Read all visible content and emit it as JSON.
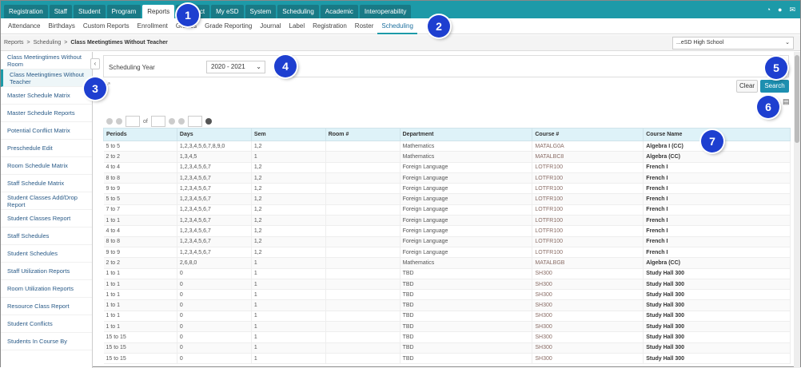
{
  "topnav": {
    "tabs": [
      {
        "label": "Registration",
        "active": false
      },
      {
        "label": "Staff",
        "active": false
      },
      {
        "label": "Student",
        "active": false
      },
      {
        "label": "Program",
        "active": false
      },
      {
        "label": "Reports",
        "active": true
      },
      {
        "label": "Conduct",
        "active": false
      },
      {
        "label": "My eSD",
        "active": false
      },
      {
        "label": "System",
        "active": false
      },
      {
        "label": "Scheduling",
        "active": false
      },
      {
        "label": "Academic",
        "active": false
      },
      {
        "label": "Interoperability",
        "active": false
      }
    ]
  },
  "subnav": {
    "items": [
      {
        "label": "Attendance",
        "active": false
      },
      {
        "label": "Birthdays",
        "active": false
      },
      {
        "label": "Custom Reports",
        "active": false
      },
      {
        "label": "Enrollment",
        "active": false
      },
      {
        "label": "Grades",
        "active": false
      },
      {
        "label": "Grade Reporting",
        "active": false
      },
      {
        "label": "Journal",
        "active": false
      },
      {
        "label": "Label",
        "active": false
      },
      {
        "label": "Registration",
        "active": false
      },
      {
        "label": "Roster",
        "active": false
      },
      {
        "label": "Scheduling",
        "active": true
      }
    ]
  },
  "breadcrumb": {
    "items": [
      "Reports",
      "Scheduling"
    ],
    "current": "Class Meetingtimes Without Teacher"
  },
  "school_select": {
    "value": "...eSD High School"
  },
  "sidebar": {
    "items": [
      {
        "label": "Class Meetingtimes Without Room",
        "active": false
      },
      {
        "label": "Class Meetingtimes Without Teacher",
        "active": true
      },
      {
        "label": "Master Schedule Matrix",
        "active": false
      },
      {
        "label": "Master Schedule Reports",
        "active": false
      },
      {
        "label": "Potential Conflict Matrix",
        "active": false
      },
      {
        "label": "Preschedule Edit",
        "active": false
      },
      {
        "label": "Room Schedule Matrix",
        "active": false
      },
      {
        "label": "Staff Schedule Matrix",
        "active": false
      },
      {
        "label": "Student Classes Add/Drop Report",
        "active": false
      },
      {
        "label": "Student Classes Report",
        "active": false
      },
      {
        "label": "Staff Schedules",
        "active": false
      },
      {
        "label": "Student Schedules",
        "active": false
      },
      {
        "label": "Staff Utilization Reports",
        "active": false
      },
      {
        "label": "Room Utilization Reports",
        "active": false
      },
      {
        "label": "Resource Class Report",
        "active": false
      },
      {
        "label": "Student Conflicts",
        "active": false
      },
      {
        "label": "Students In Course By",
        "active": false
      }
    ]
  },
  "filter": {
    "label": "Scheduling Year",
    "year_value": "2020 - 2021"
  },
  "buttons": {
    "clear": "Clear",
    "search": "Search"
  },
  "pager": {
    "of_label": "of"
  },
  "table": {
    "columns": [
      "Periods",
      "Days",
      "Sem",
      "Room #",
      "Department",
      "Course #",
      "Course Name"
    ],
    "rows": [
      [
        "5 to 5",
        "1,2,3,4,5,6,7,8,9,0",
        "1,2",
        "",
        "Mathematics",
        "MATALG0A",
        "Algebra I (CC)"
      ],
      [
        "2 to 2",
        "1,3,4,5",
        "1",
        "",
        "Mathematics",
        "MATALBC8",
        "Algebra (CC)"
      ],
      [
        "4 to 4",
        "1,2,3,4,5,6,7",
        "1,2",
        "",
        "Foreign Language",
        "LOTFR100",
        "French I"
      ],
      [
        "8 to 8",
        "1,2,3,4,5,6,7",
        "1,2",
        "",
        "Foreign Language",
        "LOTFR100",
        "French I"
      ],
      [
        "9 to 9",
        "1,2,3,4,5,6,7",
        "1,2",
        "",
        "Foreign Language",
        "LOTFR100",
        "French I"
      ],
      [
        "5 to 5",
        "1,2,3,4,5,6,7",
        "1,2",
        "",
        "Foreign Language",
        "LOTFR100",
        "French I"
      ],
      [
        "7 to 7",
        "1,2,3,4,5,6,7",
        "1,2",
        "",
        "Foreign Language",
        "LOTFR100",
        "French I"
      ],
      [
        "1 to 1",
        "1,2,3,4,5,6,7",
        "1,2",
        "",
        "Foreign Language",
        "LOTFR100",
        "French I"
      ],
      [
        "4 to 4",
        "1,2,3,4,5,6,7",
        "1,2",
        "",
        "Foreign Language",
        "LOTFR100",
        "French I"
      ],
      [
        "8 to 8",
        "1,2,3,4,5,6,7",
        "1,2",
        "",
        "Foreign Language",
        "LOTFR100",
        "French I"
      ],
      [
        "9 to 9",
        "1,2,3,4,5,6,7",
        "1,2",
        "",
        "Foreign Language",
        "LOTFR100",
        "French I"
      ],
      [
        "2 to 2",
        "2,6,8,0",
        "1",
        "",
        "Mathematics",
        "MATALBGB",
        "Algebra (CC)"
      ],
      [
        "1 to 1",
        "0",
        "1",
        "",
        "TBD",
        "SH300",
        "Study Hall 300"
      ],
      [
        "1 to 1",
        "0",
        "1",
        "",
        "TBD",
        "SH300",
        "Study Hall 300"
      ],
      [
        "1 to 1",
        "0",
        "1",
        "",
        "TBD",
        "SH300",
        "Study Hall 300"
      ],
      [
        "1 to 1",
        "0",
        "1",
        "",
        "TBD",
        "SH300",
        "Study Hall 300"
      ],
      [
        "1 to 1",
        "0",
        "1",
        "",
        "TBD",
        "SH300",
        "Study Hall 300"
      ],
      [
        "1 to 1",
        "0",
        "1",
        "",
        "TBD",
        "SH300",
        "Study Hall 300"
      ],
      [
        "15 to 15",
        "0",
        "1",
        "",
        "TBD",
        "SH300",
        "Study Hall 300"
      ],
      [
        "15 to 15",
        "0",
        "1",
        "",
        "TBD",
        "SH300",
        "Study Hall 300"
      ],
      [
        "15 to 15",
        "0",
        "1",
        "",
        "TBD",
        "SH300",
        "Study Hall 300"
      ]
    ]
  },
  "callouts": [
    "1",
    "2",
    "3",
    "4",
    "5",
    "6",
    "7"
  ],
  "colors": {
    "header": "#1d9aa8",
    "accent": "#1d8fb0",
    "callout": "#1e3fd0",
    "table_header": "#def2f8"
  }
}
